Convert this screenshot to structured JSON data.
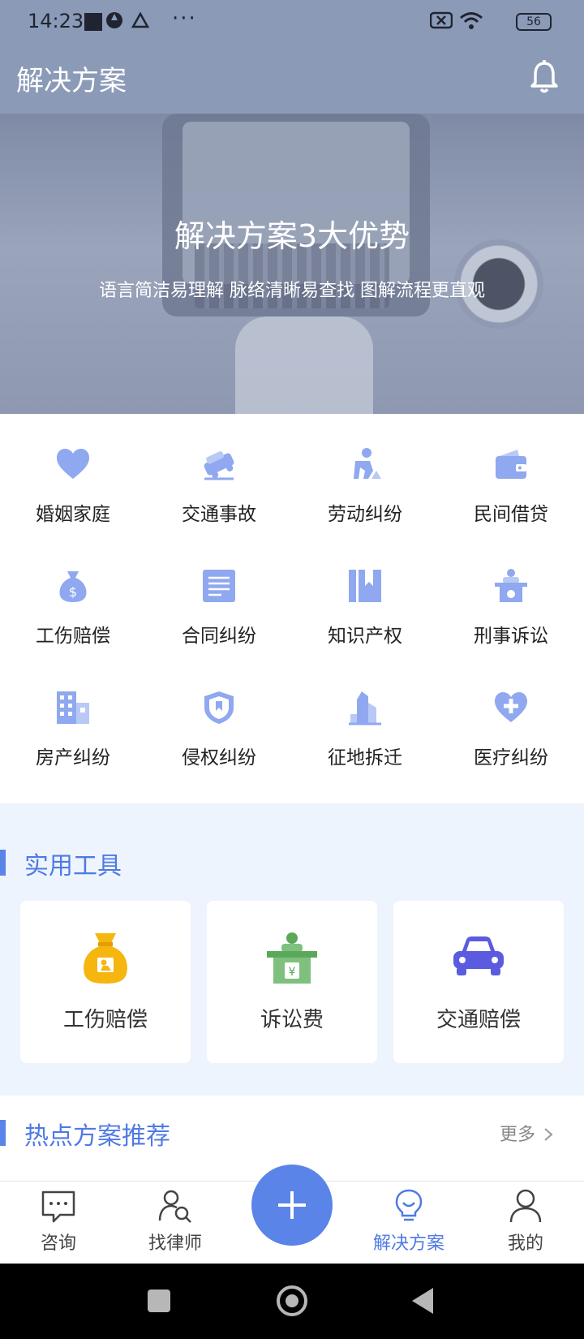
{
  "status_bar": {
    "time": "14:23",
    "battery": "56"
  },
  "header": {
    "title": "解决方案"
  },
  "banner": {
    "headline": "解决方案3大优势",
    "subline": "语言简洁易理解 脉络清晰易查找 图解流程更直观"
  },
  "categories": [
    {
      "label": "婚姻家庭",
      "icon": "heart-icon"
    },
    {
      "label": "交通事故",
      "icon": "car-crash-icon"
    },
    {
      "label": "劳动纠纷",
      "icon": "worker-icon"
    },
    {
      "label": "民间借贷",
      "icon": "wallet-icon"
    },
    {
      "label": "工伤赔偿",
      "icon": "money-bag-icon"
    },
    {
      "label": "合同纠纷",
      "icon": "document-icon"
    },
    {
      "label": "知识产权",
      "icon": "bookmark-book-icon"
    },
    {
      "label": "刑事诉讼",
      "icon": "court-podium-icon"
    },
    {
      "label": "房产纠纷",
      "icon": "building-icon"
    },
    {
      "label": "侵权纠纷",
      "icon": "shield-icon"
    },
    {
      "label": "征地拆迁",
      "icon": "skyscraper-icon"
    },
    {
      "label": "医疗纠纷",
      "icon": "medical-heart-icon"
    }
  ],
  "tools": {
    "title": "实用工具",
    "items": [
      {
        "label": "工伤赔偿",
        "icon": "money-bag-icon",
        "color": "#f5b60f"
      },
      {
        "label": "诉讼费",
        "icon": "podium-icon",
        "color": "#5aa85a"
      },
      {
        "label": "交通赔偿",
        "icon": "car-icon",
        "color": "#5b5bdf"
      }
    ]
  },
  "hot": {
    "title": "热点方案推荐",
    "more": "更多"
  },
  "nav": [
    {
      "label": "咨询",
      "icon": "chat-icon"
    },
    {
      "label": "找律师",
      "icon": "find-lawyer-icon"
    },
    {
      "label": "解决方案",
      "icon": "lightbulb-icon",
      "active": true
    },
    {
      "label": "我的",
      "icon": "user-icon"
    }
  ],
  "colors": {
    "accent": "#5b84e8",
    "header_bg": "#8b9ab7",
    "icon_blue": "#8fa8f0"
  }
}
